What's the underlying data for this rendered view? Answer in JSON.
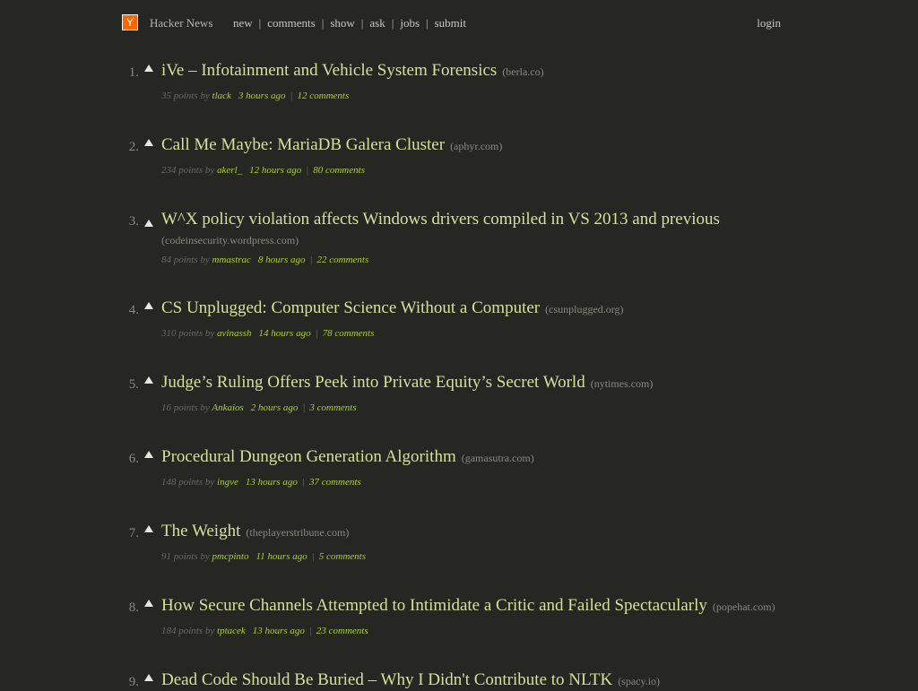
{
  "header": {
    "logo_letter": "Y",
    "site_name": "Hacker News",
    "nav": [
      {
        "label": "new"
      },
      {
        "label": "comments"
      },
      {
        "label": "show"
      },
      {
        "label": "ask"
      },
      {
        "label": "jobs"
      },
      {
        "label": "submit"
      }
    ],
    "login_label": "login"
  },
  "stories": [
    {
      "rank": "1.",
      "title": "iVe – Infotainment and Vehicle System Forensics",
      "site": "(berla.co)",
      "points": "35 points by",
      "user": "tlack",
      "age": "3 hours ago",
      "comments": "12 comments"
    },
    {
      "rank": "2.",
      "title": "Call Me Maybe: MariaDB Galera Cluster",
      "site": "(aphyr.com)",
      "points": "234 points by",
      "user": "akerl_",
      "age": "12 hours ago",
      "comments": "80 comments"
    },
    {
      "rank": "3.",
      "title": "W^X policy violation affects Windows drivers compiled in VS 2013 and previous",
      "site": "(codeinsecurity.wordpress.com)",
      "points": "84 points by",
      "user": "mmastrac",
      "age": "8 hours ago",
      "comments": "22 comments"
    },
    {
      "rank": "4.",
      "title": "CS Unplugged: Computer Science Without a Computer",
      "site": "(csunplugged.org)",
      "points": "310 points by",
      "user": "avinassh",
      "age": "14 hours ago",
      "comments": "78 comments"
    },
    {
      "rank": "5.",
      "title": "Judge’s Ruling Offers Peek into Private Equity’s Secret World",
      "site": "(nytimes.com)",
      "points": "16 points by",
      "user": "Ankaios",
      "age": "2 hours ago",
      "comments": "3 comments"
    },
    {
      "rank": "6.",
      "title": "Procedural Dungeon Generation Algorithm",
      "site": "(gamasutra.com)",
      "points": "148 points by",
      "user": "ingve",
      "age": "13 hours ago",
      "comments": "37 comments"
    },
    {
      "rank": "7.",
      "title": "The Weight",
      "site": "(theplayerstribune.com)",
      "points": "91 points by",
      "user": "pmcpinto",
      "age": "11 hours ago",
      "comments": "5 comments"
    },
    {
      "rank": "8.",
      "title": "How Secure Channels Attempted to Intimidate a Critic and Failed Spectacularly",
      "site": "(popehat.com)",
      "points": "184 points by",
      "user": "tptacek",
      "age": "13 hours ago",
      "comments": "23 comments"
    },
    {
      "rank": "9.",
      "title": "Dead Code Should Be Buried – Why I Didn't Contribute to NLTK",
      "site": "(spacy.io)",
      "points": "",
      "user": "",
      "age": "",
      "comments": ""
    }
  ],
  "colors": {
    "background": "#262622",
    "title": "#d4e09b",
    "link_green": "#a8d030",
    "logo": "#ff6600"
  }
}
